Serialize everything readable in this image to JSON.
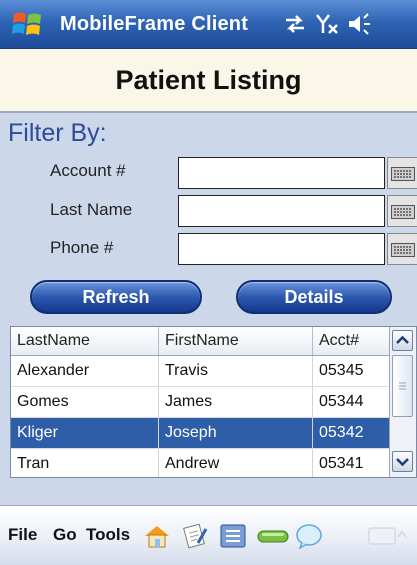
{
  "titlebar": {
    "app_title": "MobileFrame Client",
    "icons": [
      "windows-start-icon",
      "sync-arrows-icon",
      "no-signal-icon",
      "speaker-icon"
    ]
  },
  "header": {
    "page_title": "Patient Listing"
  },
  "filter": {
    "heading": "Filter By:",
    "fields": [
      {
        "label": "Account #",
        "value": ""
      },
      {
        "label": "Last Name",
        "value": ""
      },
      {
        "label": "Phone #",
        "value": ""
      }
    ]
  },
  "buttons": {
    "refresh": "Refresh",
    "details": "Details"
  },
  "grid": {
    "columns": [
      "LastName",
      "FirstName",
      "Acct#"
    ],
    "rows": [
      {
        "last": "Alexander",
        "first": "Travis",
        "acct": "05345",
        "selected": false
      },
      {
        "last": "Gomes",
        "first": "James",
        "acct": "05344",
        "selected": false
      },
      {
        "last": "Kliger",
        "first": "Joseph",
        "acct": "05342",
        "selected": true
      },
      {
        "last": "Tran",
        "first": "Andrew",
        "acct": "05341",
        "selected": false
      }
    ]
  },
  "menubar": {
    "items": [
      "File",
      "Go",
      "Tools"
    ],
    "icons": [
      "home-icon",
      "notes-icon",
      "list-icon",
      "battery-icon",
      "chat-bubble-icon",
      "keyboard-icon"
    ]
  },
  "colors": {
    "accent": "#2f5ea8",
    "panel": "#ccd8ea",
    "title_bar": "#2f64b4"
  }
}
